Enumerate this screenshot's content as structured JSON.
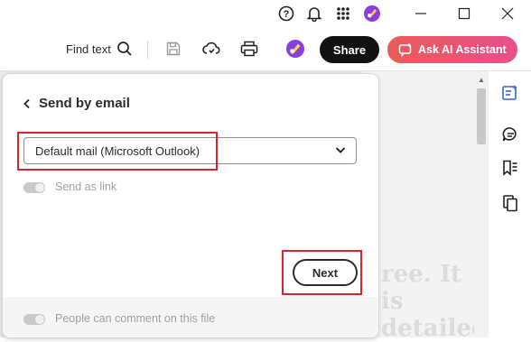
{
  "titlebar": {
    "help_icon": "help-circle-icon",
    "notifications_icon": "bell-icon",
    "apps_icon": "grid-icon",
    "avatar_icon": "avatar-icon",
    "minimize_icon": "minimize-icon",
    "maximize_icon": "maximize-icon",
    "close_icon": "close-icon"
  },
  "toolbar": {
    "find_text_label": "Find text",
    "share_label": "Share",
    "ai_assistant_label": "Ask AI Assistant"
  },
  "panel": {
    "title": "Send by email",
    "mail_select_value": "Default mail (Microsoft Outlook)",
    "send_as_link_label": "Send as link",
    "next_label": "Next",
    "comment_label": "People can comment on this file"
  },
  "document": {
    "fragment_1": "ree. It is",
    "fragment_2": "detailed"
  },
  "colors": {
    "accent_red": "#d8262d",
    "ai_gradient_start": "#ec5a57",
    "ai_gradient_end": "#e84f8c",
    "rail_active": "#3b63d1"
  }
}
